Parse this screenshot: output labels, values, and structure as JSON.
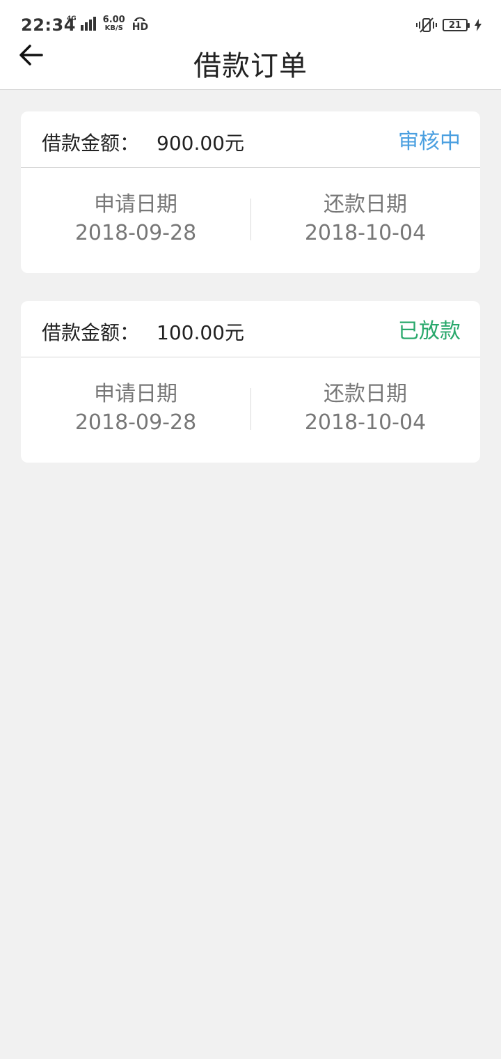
{
  "status_bar": {
    "time": "22:34",
    "network": "4G",
    "speed_value": "6.00",
    "speed_unit": "KB/S",
    "hd": "HD",
    "battery": "21"
  },
  "header": {
    "title": "借款订单",
    "back_icon": "arrow-left-icon"
  },
  "orders": [
    {
      "amount_label": "借款金额：",
      "amount": "900.00元",
      "status": "审核中",
      "status_color": "#4a9fe0",
      "apply_label": "申请日期",
      "apply_date": "2018-09-28",
      "repay_label": "还款日期",
      "repay_date": "2018-10-04"
    },
    {
      "amount_label": "借款金额：",
      "amount": "100.00元",
      "status": "已放款",
      "status_color": "#28a86b",
      "apply_label": "申请日期",
      "apply_date": "2018-09-28",
      "repay_label": "还款日期",
      "repay_date": "2018-10-04"
    }
  ]
}
